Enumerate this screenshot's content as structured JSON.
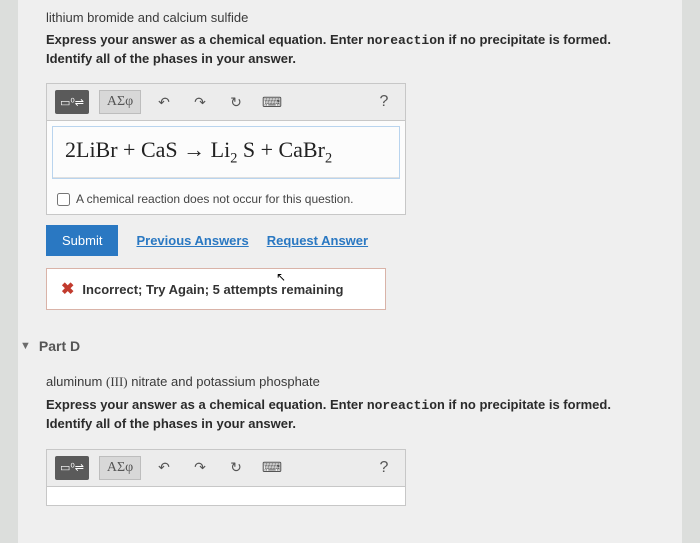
{
  "partC": {
    "intro": "lithium bromide and calcium sulfide",
    "instruction_a": "Express your answer as a chemical equation. Enter ",
    "instruction_nr": "noreaction",
    "instruction_b": " if no precipitate is formed. Identify all of the phases in your answer.",
    "toolbar": {
      "template": "▭⁰⇌",
      "sigma": "ΑΣφ",
      "undo": "↶",
      "redo": "↷",
      "reset": "↻",
      "keyboard": "⌨",
      "help": "?"
    },
    "equation_html": "2LiBr + CaS → Li<sub>2</sub> S + CaBr<sub>2</sub>",
    "checkbox_label": "A chemical reaction does not occur for this question.",
    "submit": "Submit",
    "prev_answers": "Previous Answers",
    "request_answer": "Request Answer",
    "feedback": "Incorrect; Try Again; 5 attempts remaining"
  },
  "partD": {
    "title": "Part D",
    "intro_a": "aluminum",
    "intro_roman": "(III)",
    "intro_b": " nitrate and potassium phosphate",
    "instruction_a": "Express your answer as a chemical equation. Enter ",
    "instruction_nr": "noreaction",
    "instruction_b": " if no precipitate is formed. Identify all of the phases in your answer.",
    "toolbar": {
      "template": "▭⁰⇌",
      "sigma": "ΑΣφ",
      "undo": "↶",
      "redo": "↷",
      "reset": "↻",
      "keyboard": "⌨",
      "help": "?"
    }
  }
}
